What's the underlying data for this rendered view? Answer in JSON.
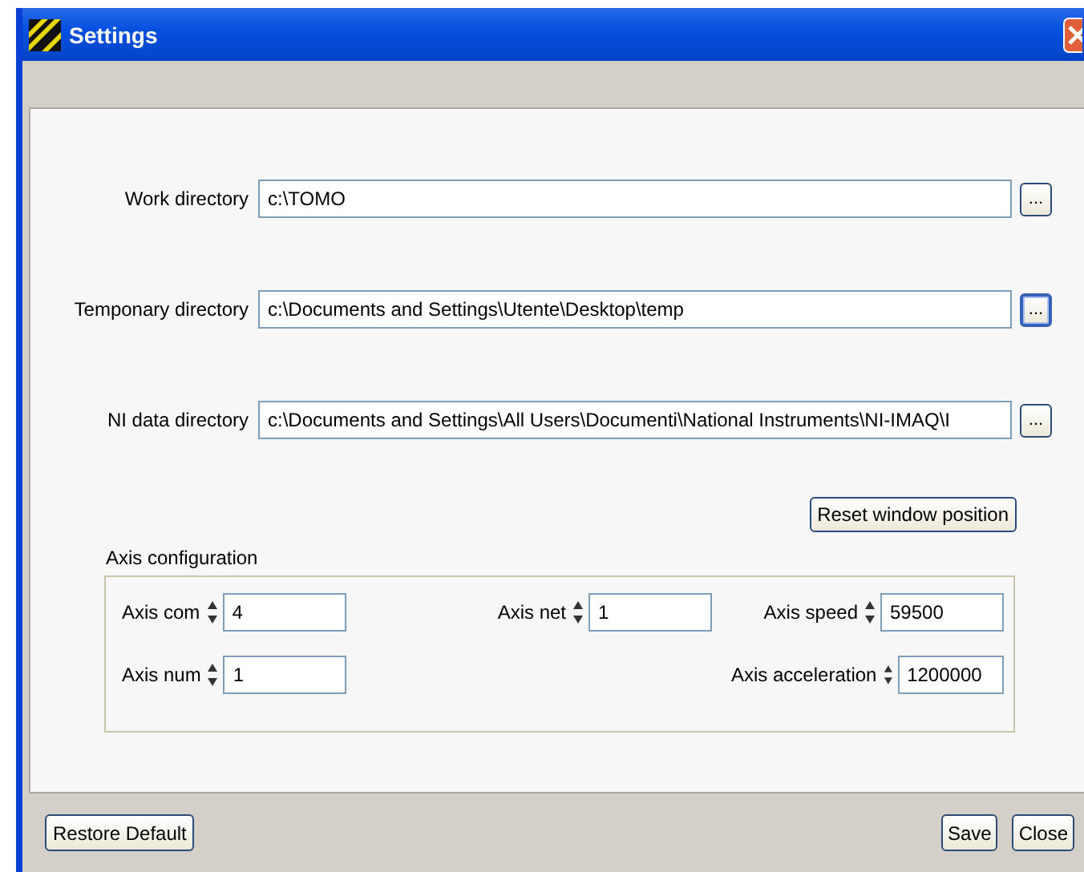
{
  "window": {
    "title": "Settings"
  },
  "directories": [
    {
      "label": "Work directory",
      "value": "c:\\TOMO",
      "browse": "...",
      "focused": false
    },
    {
      "label": "Temponary directory",
      "value": "c:\\Documents and Settings\\Utente\\Desktop\\temp",
      "browse": "...",
      "focused": true
    },
    {
      "label": "NI data directory",
      "value": "c:\\Documents and Settings\\All Users\\Documenti\\National Instruments\\NI-IMAQ\\I",
      "browse": "...",
      "focused": false
    }
  ],
  "reset_button": "Reset window position",
  "axis": {
    "title": "Axis configuration",
    "rows": [
      {
        "left": {
          "label": "Axis com",
          "value": "4"
        },
        "middle": {
          "label": "Axis net",
          "value": "1"
        },
        "right": {
          "label": "Axis speed",
          "value": "59500"
        }
      },
      {
        "left": {
          "label": "Axis num",
          "value": "1"
        },
        "right": {
          "label": "Axis acceleration",
          "value": "1200000"
        }
      }
    ]
  },
  "footer": {
    "left": [
      "Restore Default"
    ],
    "right": [
      "Save",
      "Close"
    ]
  }
}
